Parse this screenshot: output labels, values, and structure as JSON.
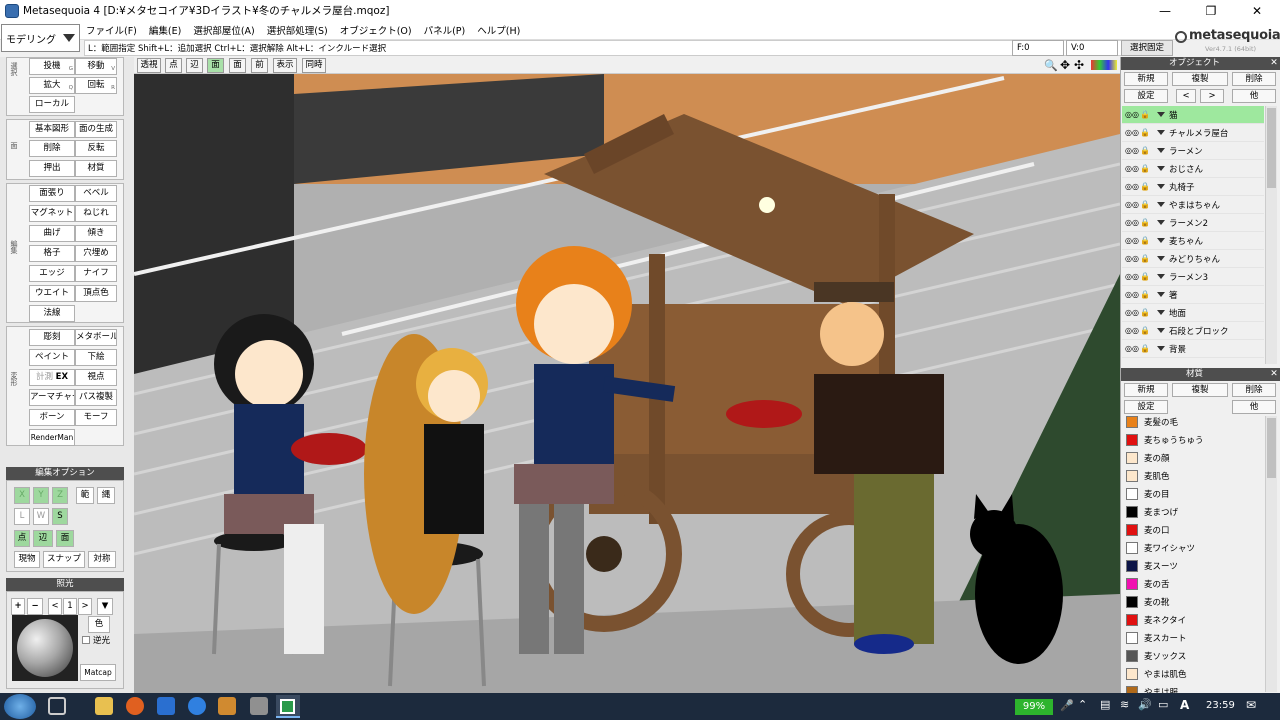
{
  "window": {
    "title": "Metasequoia 4 [D:¥メタセコイア¥3Dイラスト¥冬のチャルメラ屋台.mqoz]",
    "min_icon": "minimize-icon",
    "max_icon": "maximize-icon",
    "close_icon": "close-icon"
  },
  "mode": {
    "label": "モデリング"
  },
  "menu": [
    "ファイル(F)",
    "編集(E)",
    "選択部屋位(A)",
    "選択部処理(S)",
    "オブジェクト(O)",
    "パネル(P)",
    "ヘルプ(H)"
  ],
  "hint": "L：範囲指定  Shift+L：追加選択  Ctrl+L：選択解除  Alt+L：インクルード選択",
  "status": {
    "f": "F:0",
    "v": "V:0",
    "selfix": "選択固定"
  },
  "logo": {
    "main": "metasequoia4",
    "ver": "Ver4.7.1 (64bit)"
  },
  "toolbar": [
    "透視",
    "点",
    "辺",
    "面",
    "面",
    "前",
    "表示",
    "同時"
  ],
  "left_groups": {
    "g1": [
      "投機",
      "移動",
      "拡大",
      "回転",
      "ローカル"
    ],
    "g1_keys": [
      "G",
      "V",
      "Q",
      "R",
      ""
    ],
    "g2": [
      "基本図形",
      "面の生成",
      "削除",
      "反転",
      "押出",
      "材質"
    ],
    "g3": [
      "面張り",
      "ベベル",
      "マグネット",
      "ねじれ",
      "曲げ",
      "傾き",
      "格子",
      "穴埋め",
      "エッジ",
      "ナイフ",
      "ウエイト",
      "頂点色",
      "法線"
    ],
    "g4": [
      "彫刻",
      "メタボール",
      "ペイント",
      "下絵",
      "計測",
      "視点",
      "アーマチャー",
      "パス複製",
      "ボーン",
      "モーフ",
      "RenderMan"
    ],
    "g4_ex": "EX",
    "labels": [
      "選択",
      "面",
      "編集",
      "変形"
    ]
  },
  "edit_options": {
    "title": "編集オプション",
    "axes": [
      "X",
      "Y",
      "Z"
    ],
    "row1b": [
      "範",
      "縄"
    ],
    "row2": [
      "L",
      "W",
      "S"
    ],
    "row3": [
      "点",
      "辺",
      "面"
    ],
    "row4": [
      "現物",
      "スナップ",
      "対称"
    ]
  },
  "light": {
    "title": "照光",
    "num": "1",
    "color": "色",
    "backlight": "逆光",
    "matcap": "Matcap"
  },
  "objects_panel": {
    "title": "オブジェクト",
    "buttons": [
      "新規",
      "複製",
      "削除",
      "設定",
      "<",
      ">",
      "他"
    ],
    "items": [
      "猫",
      "チャルメラ屋台",
      "ラーメン",
      "おじさん",
      "丸椅子",
      "やまはちゃん",
      "ラーメン2",
      "麦ちゃん",
      "みどりちゃん",
      "ラーメン3",
      "箸",
      "地面",
      "石段とブロック",
      "背景"
    ]
  },
  "materials_panel": {
    "title": "材質",
    "buttons": [
      "新規",
      "複製",
      "削除",
      "設定",
      "他"
    ],
    "items": [
      {
        "name": "麦髪の毛",
        "color": "#e8811a"
      },
      {
        "name": "麦ちゅうちゅう",
        "color": "#e01010"
      },
      {
        "name": "麦の顔",
        "color": "#fde7cc"
      },
      {
        "name": "麦肌色",
        "color": "#fde7cc"
      },
      {
        "name": "麦の目",
        "color": "#ffffff"
      },
      {
        "name": "麦まつげ",
        "color": "#000000"
      },
      {
        "name": "麦の口",
        "color": "#e01010"
      },
      {
        "name": "麦ワイシャツ",
        "color": "#ffffff"
      },
      {
        "name": "麦スーツ",
        "color": "#0c1446"
      },
      {
        "name": "麦の舌",
        "color": "#f010b0"
      },
      {
        "name": "麦の靴",
        "color": "#000000"
      },
      {
        "name": "麦ネクタイ",
        "color": "#e01010"
      },
      {
        "name": "麦スカート",
        "color": "#ffffff"
      },
      {
        "name": "麦ソックス",
        "color": "#555555"
      },
      {
        "name": "やまは肌色",
        "color": "#fde7cc"
      },
      {
        "name": "やまは服",
        "color": "#b06a1a"
      }
    ]
  },
  "taskbar": {
    "battery": "99%",
    "time": "23:59"
  },
  "colors": {
    "selected_row": "#9ee89e",
    "accent_green": "#9ed89e",
    "taskbar": "#1c2a3d"
  }
}
